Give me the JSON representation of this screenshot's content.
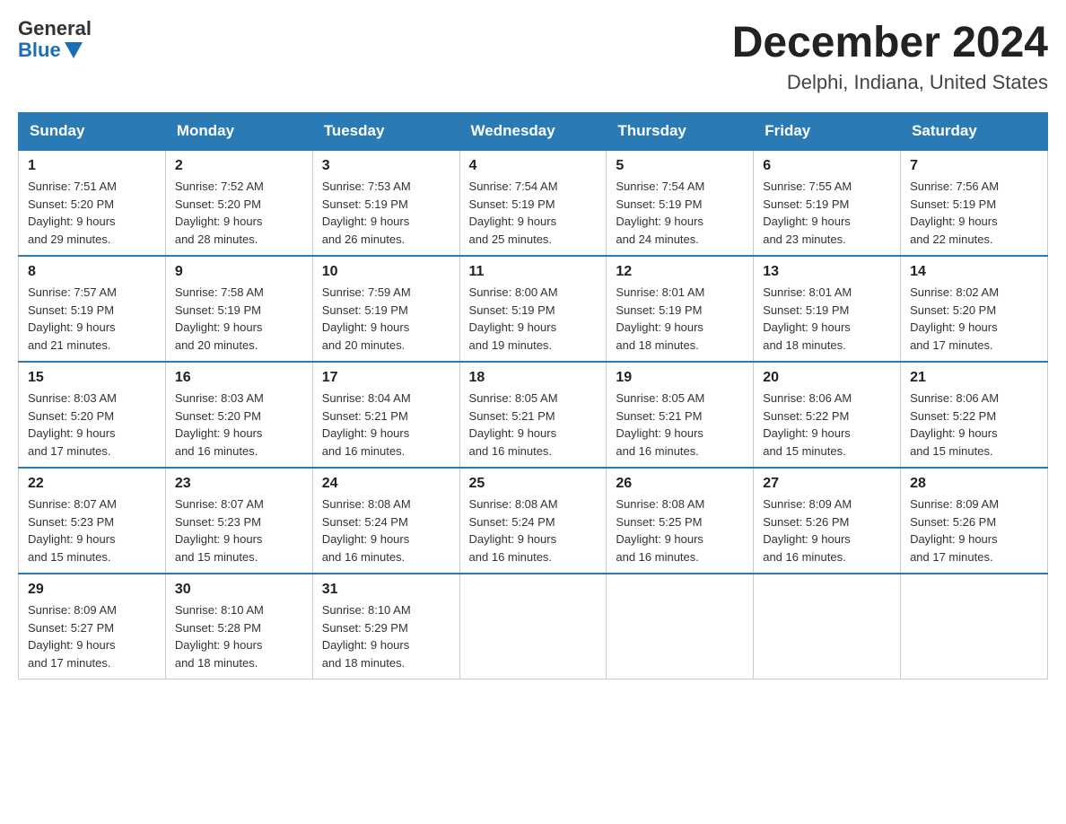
{
  "logo": {
    "general": "General",
    "blue": "Blue"
  },
  "title": "December 2024",
  "subtitle": "Delphi, Indiana, United States",
  "headers": [
    "Sunday",
    "Monday",
    "Tuesday",
    "Wednesday",
    "Thursday",
    "Friday",
    "Saturday"
  ],
  "weeks": [
    [
      {
        "day": "1",
        "sunrise": "7:51 AM",
        "sunset": "5:20 PM",
        "daylight": "9 hours and 29 minutes."
      },
      {
        "day": "2",
        "sunrise": "7:52 AM",
        "sunset": "5:20 PM",
        "daylight": "9 hours and 28 minutes."
      },
      {
        "day": "3",
        "sunrise": "7:53 AM",
        "sunset": "5:19 PM",
        "daylight": "9 hours and 26 minutes."
      },
      {
        "day": "4",
        "sunrise": "7:54 AM",
        "sunset": "5:19 PM",
        "daylight": "9 hours and 25 minutes."
      },
      {
        "day": "5",
        "sunrise": "7:54 AM",
        "sunset": "5:19 PM",
        "daylight": "9 hours and 24 minutes."
      },
      {
        "day": "6",
        "sunrise": "7:55 AM",
        "sunset": "5:19 PM",
        "daylight": "9 hours and 23 minutes."
      },
      {
        "day": "7",
        "sunrise": "7:56 AM",
        "sunset": "5:19 PM",
        "daylight": "9 hours and 22 minutes."
      }
    ],
    [
      {
        "day": "8",
        "sunrise": "7:57 AM",
        "sunset": "5:19 PM",
        "daylight": "9 hours and 21 minutes."
      },
      {
        "day": "9",
        "sunrise": "7:58 AM",
        "sunset": "5:19 PM",
        "daylight": "9 hours and 20 minutes."
      },
      {
        "day": "10",
        "sunrise": "7:59 AM",
        "sunset": "5:19 PM",
        "daylight": "9 hours and 20 minutes."
      },
      {
        "day": "11",
        "sunrise": "8:00 AM",
        "sunset": "5:19 PM",
        "daylight": "9 hours and 19 minutes."
      },
      {
        "day": "12",
        "sunrise": "8:01 AM",
        "sunset": "5:19 PM",
        "daylight": "9 hours and 18 minutes."
      },
      {
        "day": "13",
        "sunrise": "8:01 AM",
        "sunset": "5:19 PM",
        "daylight": "9 hours and 18 minutes."
      },
      {
        "day": "14",
        "sunrise": "8:02 AM",
        "sunset": "5:20 PM",
        "daylight": "9 hours and 17 minutes."
      }
    ],
    [
      {
        "day": "15",
        "sunrise": "8:03 AM",
        "sunset": "5:20 PM",
        "daylight": "9 hours and 17 minutes."
      },
      {
        "day": "16",
        "sunrise": "8:03 AM",
        "sunset": "5:20 PM",
        "daylight": "9 hours and 16 minutes."
      },
      {
        "day": "17",
        "sunrise": "8:04 AM",
        "sunset": "5:21 PM",
        "daylight": "9 hours and 16 minutes."
      },
      {
        "day": "18",
        "sunrise": "8:05 AM",
        "sunset": "5:21 PM",
        "daylight": "9 hours and 16 minutes."
      },
      {
        "day": "19",
        "sunrise": "8:05 AM",
        "sunset": "5:21 PM",
        "daylight": "9 hours and 16 minutes."
      },
      {
        "day": "20",
        "sunrise": "8:06 AM",
        "sunset": "5:22 PM",
        "daylight": "9 hours and 15 minutes."
      },
      {
        "day": "21",
        "sunrise": "8:06 AM",
        "sunset": "5:22 PM",
        "daylight": "9 hours and 15 minutes."
      }
    ],
    [
      {
        "day": "22",
        "sunrise": "8:07 AM",
        "sunset": "5:23 PM",
        "daylight": "9 hours and 15 minutes."
      },
      {
        "day": "23",
        "sunrise": "8:07 AM",
        "sunset": "5:23 PM",
        "daylight": "9 hours and 15 minutes."
      },
      {
        "day": "24",
        "sunrise": "8:08 AM",
        "sunset": "5:24 PM",
        "daylight": "9 hours and 16 minutes."
      },
      {
        "day": "25",
        "sunrise": "8:08 AM",
        "sunset": "5:24 PM",
        "daylight": "9 hours and 16 minutes."
      },
      {
        "day": "26",
        "sunrise": "8:08 AM",
        "sunset": "5:25 PM",
        "daylight": "9 hours and 16 minutes."
      },
      {
        "day": "27",
        "sunrise": "8:09 AM",
        "sunset": "5:26 PM",
        "daylight": "9 hours and 16 minutes."
      },
      {
        "day": "28",
        "sunrise": "8:09 AM",
        "sunset": "5:26 PM",
        "daylight": "9 hours and 17 minutes."
      }
    ],
    [
      {
        "day": "29",
        "sunrise": "8:09 AM",
        "sunset": "5:27 PM",
        "daylight": "9 hours and 17 minutes."
      },
      {
        "day": "30",
        "sunrise": "8:10 AM",
        "sunset": "5:28 PM",
        "daylight": "9 hours and 18 minutes."
      },
      {
        "day": "31",
        "sunrise": "8:10 AM",
        "sunset": "5:29 PM",
        "daylight": "9 hours and 18 minutes."
      },
      null,
      null,
      null,
      null
    ]
  ],
  "labels": {
    "sunrise": "Sunrise:",
    "sunset": "Sunset:",
    "daylight": "Daylight: 9 hours"
  }
}
